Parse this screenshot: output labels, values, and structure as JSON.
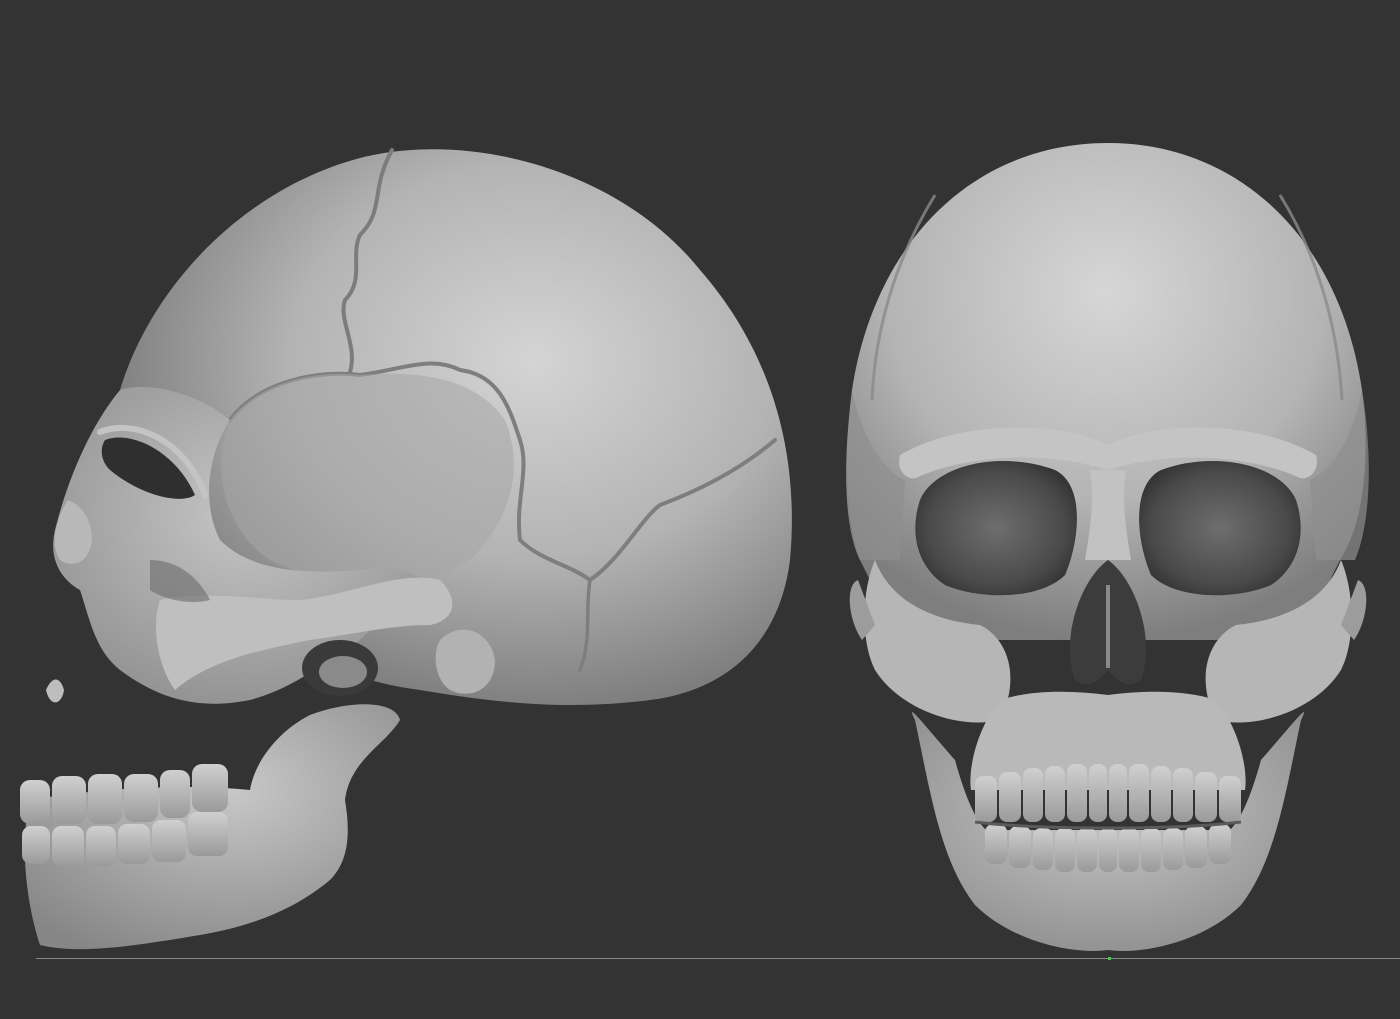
{
  "scene": {
    "background_color": "#333333",
    "bone_base_color": "#a9a9a9",
    "bone_highlight_color": "#d2d2d2",
    "bone_shadow_color": "#3d3d3d",
    "ground_line_color": "#8a8a8a",
    "axis_marker_color": "#4fc25a"
  },
  "models": [
    {
      "name": "skull-side-view",
      "view": "lateral"
    },
    {
      "name": "skull-front-view",
      "view": "frontal"
    }
  ]
}
